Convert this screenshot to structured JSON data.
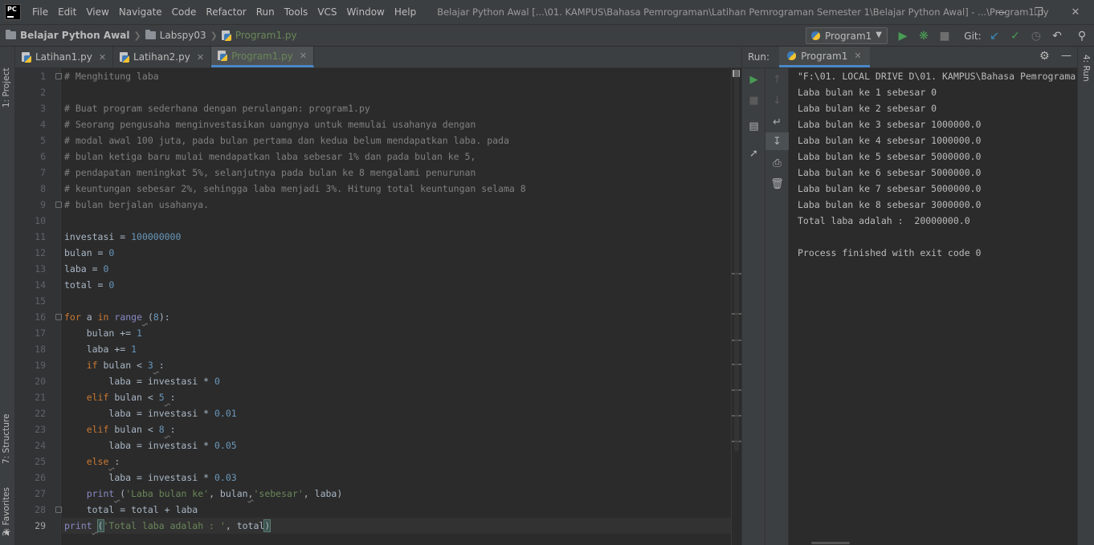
{
  "menubar": {
    "logo_text": "PC",
    "items": [
      "File",
      "Edit",
      "View",
      "Navigate",
      "Code",
      "Refactor",
      "Run",
      "Tools",
      "VCS",
      "Window",
      "Help"
    ],
    "window_title": "Belajar Python Awal [...\\01. KAMPUS\\Bahasa Pemrograman\\Latihan Pemrograman Semester 1\\Belajar Python Awal] - ...\\Program1.py"
  },
  "navbar": {
    "breadcrumbs": [
      "Belajar Python Awal",
      "Labspy03",
      "Program1.py"
    ],
    "run_config": "Program1",
    "git_label": "Git:"
  },
  "icons": {
    "run": "run-icon",
    "debug": "debug-icon",
    "stop": "stop-icon",
    "update": "vcs-update-icon",
    "commit": "vcs-commit-icon",
    "history": "history-icon",
    "rollback": "rollback-icon",
    "search": "search-icon"
  },
  "colors": {
    "run_green": "#499c54",
    "accent_blue": "#4a88c7",
    "keyword": "#cc7832",
    "number": "#6897bb",
    "string": "#6a8759",
    "comment": "#808080"
  },
  "side_tabs": {
    "project": "1: Project",
    "structure": "7: Structure",
    "favorites": "2: Favorites",
    "run": "4: Run"
  },
  "editor": {
    "tabs": [
      {
        "label": "Latihan1.py",
        "active": false
      },
      {
        "label": "Latihan2.py",
        "active": false
      },
      {
        "label": "Program1.py",
        "active": true
      }
    ],
    "line_numbers": [
      "1",
      "2",
      "3",
      "4",
      "5",
      "6",
      "7",
      "8",
      "9",
      "10",
      "11",
      "12",
      "13",
      "14",
      "15",
      "16",
      "17",
      "18",
      "19",
      "20",
      "21",
      "22",
      "23",
      "24",
      "25",
      "26",
      "27",
      "28",
      "29"
    ],
    "code": {
      "l1": "# Menghitung laba",
      "l3": "# Buat program sederhana dengan perulangan: program1.py",
      "l4": "# Seorang pengusaha menginvestasikan uangnya untuk memulai usahanya dengan",
      "l5": "# modal awal 100 juta, pada bulan pertama dan kedua belum mendapatkan laba. pada",
      "l6": "# bulan ketiga baru mulai mendapatkan laba sebesar 1% dan pada bulan ke 5,",
      "l7": "# pendapatan meningkat 5%, selanjutnya pada bulan ke 8 mengalami penurunan",
      "l8": "# keuntungan sebesar 2%, sehingga laba menjadi 3%. Hitung total keuntungan selama 8",
      "l9": "# bulan berjalan usahanya.",
      "investasi": "investasi",
      "investasi_val": "100000000",
      "bulan": "bulan",
      "laba": "laba",
      "total": "total",
      "zero": "0",
      "one": "1",
      "three": "3",
      "five": "5",
      "eight": "8",
      "v001": "0.01",
      "v005": "0.05",
      "v003": "0.03",
      "kw_for": "for",
      "kw_in": "in",
      "kw_if": "if",
      "kw_elif": "elif",
      "kw_else": "else",
      "fn_range": "range",
      "fn_print": "print",
      "str_laba_bulan": "'Laba bulan ke'",
      "str_sebesar": "'sebesar'",
      "str_total": "'Total laba adalah : '",
      "var_a": "a",
      "eq": " = ",
      "pluseq": " += ",
      "lt": " < ",
      "times": " * ",
      "plus": " + "
    }
  },
  "run_window": {
    "label": "Run:",
    "tab": "Program1",
    "output": [
      "\"F:\\01. LOCAL DRIVE D\\01. KAMPUS\\Bahasa Pemrograma",
      "Laba bulan ke 1 sebesar 0",
      "Laba bulan ke 2 sebesar 0",
      "Laba bulan ke 3 sebesar 1000000.0",
      "Laba bulan ke 4 sebesar 1000000.0",
      "Laba bulan ke 5 sebesar 5000000.0",
      "Laba bulan ke 6 sebesar 5000000.0",
      "Laba bulan ke 7 sebesar 5000000.0",
      "Laba bulan ke 8 sebesar 3000000.0",
      "Total laba adalah :  20000000.0",
      "",
      "Process finished with exit code 0"
    ]
  }
}
